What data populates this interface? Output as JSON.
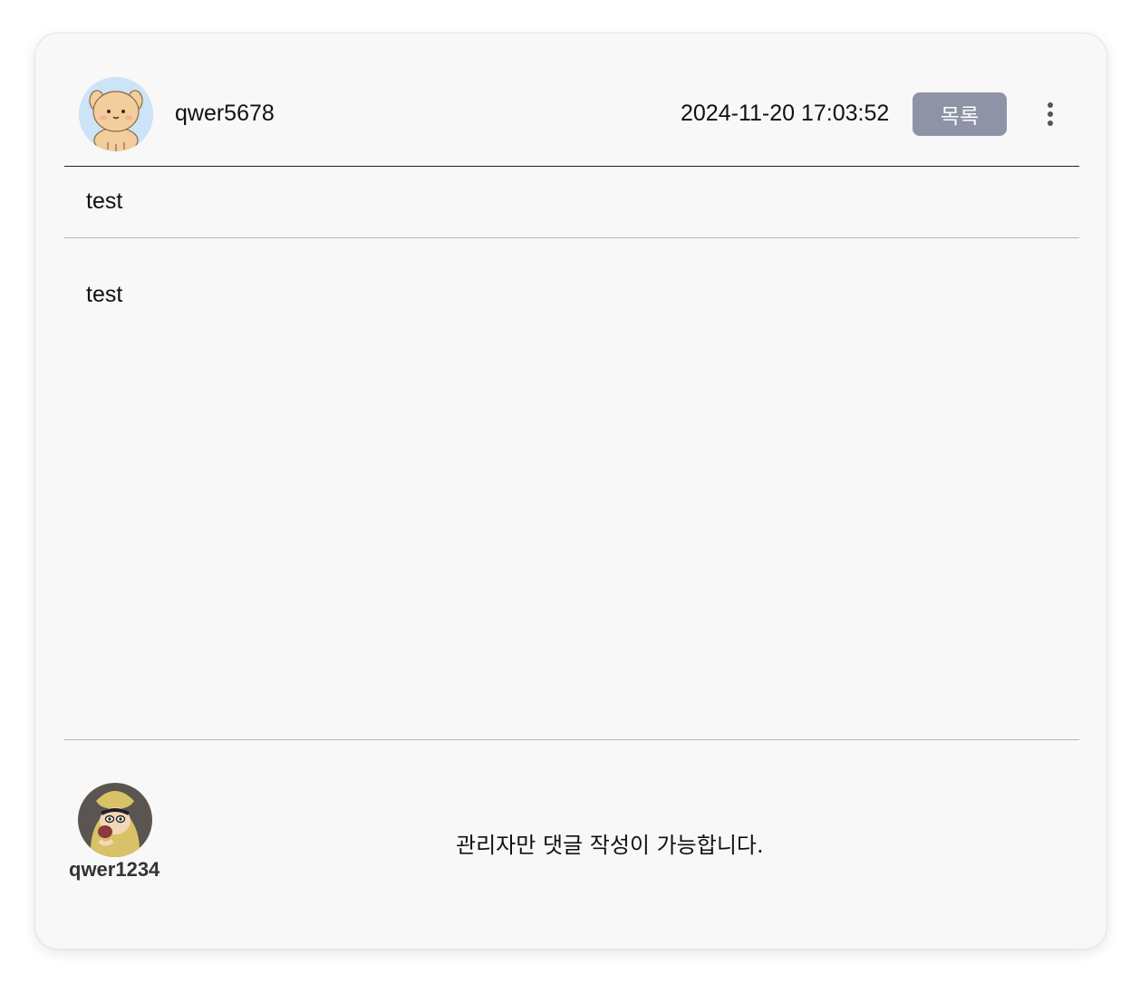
{
  "post": {
    "author": "qwer5678",
    "timestamp": "2024-11-20 17:03:52",
    "list_button_label": "목록",
    "title": "test",
    "content": "test"
  },
  "icons": {
    "author_avatar": "puppy-avatar-icon",
    "more_menu": "more-vertical-icon",
    "commenter_avatar": "cartoon-kid-avatar-icon"
  },
  "comments": {
    "user": "qwer1234",
    "notice": "관리자만 댓글 작성이 가능합니다."
  },
  "colors": {
    "button_bg": "#8e93a6",
    "card_bg": "#f8f8f8"
  }
}
